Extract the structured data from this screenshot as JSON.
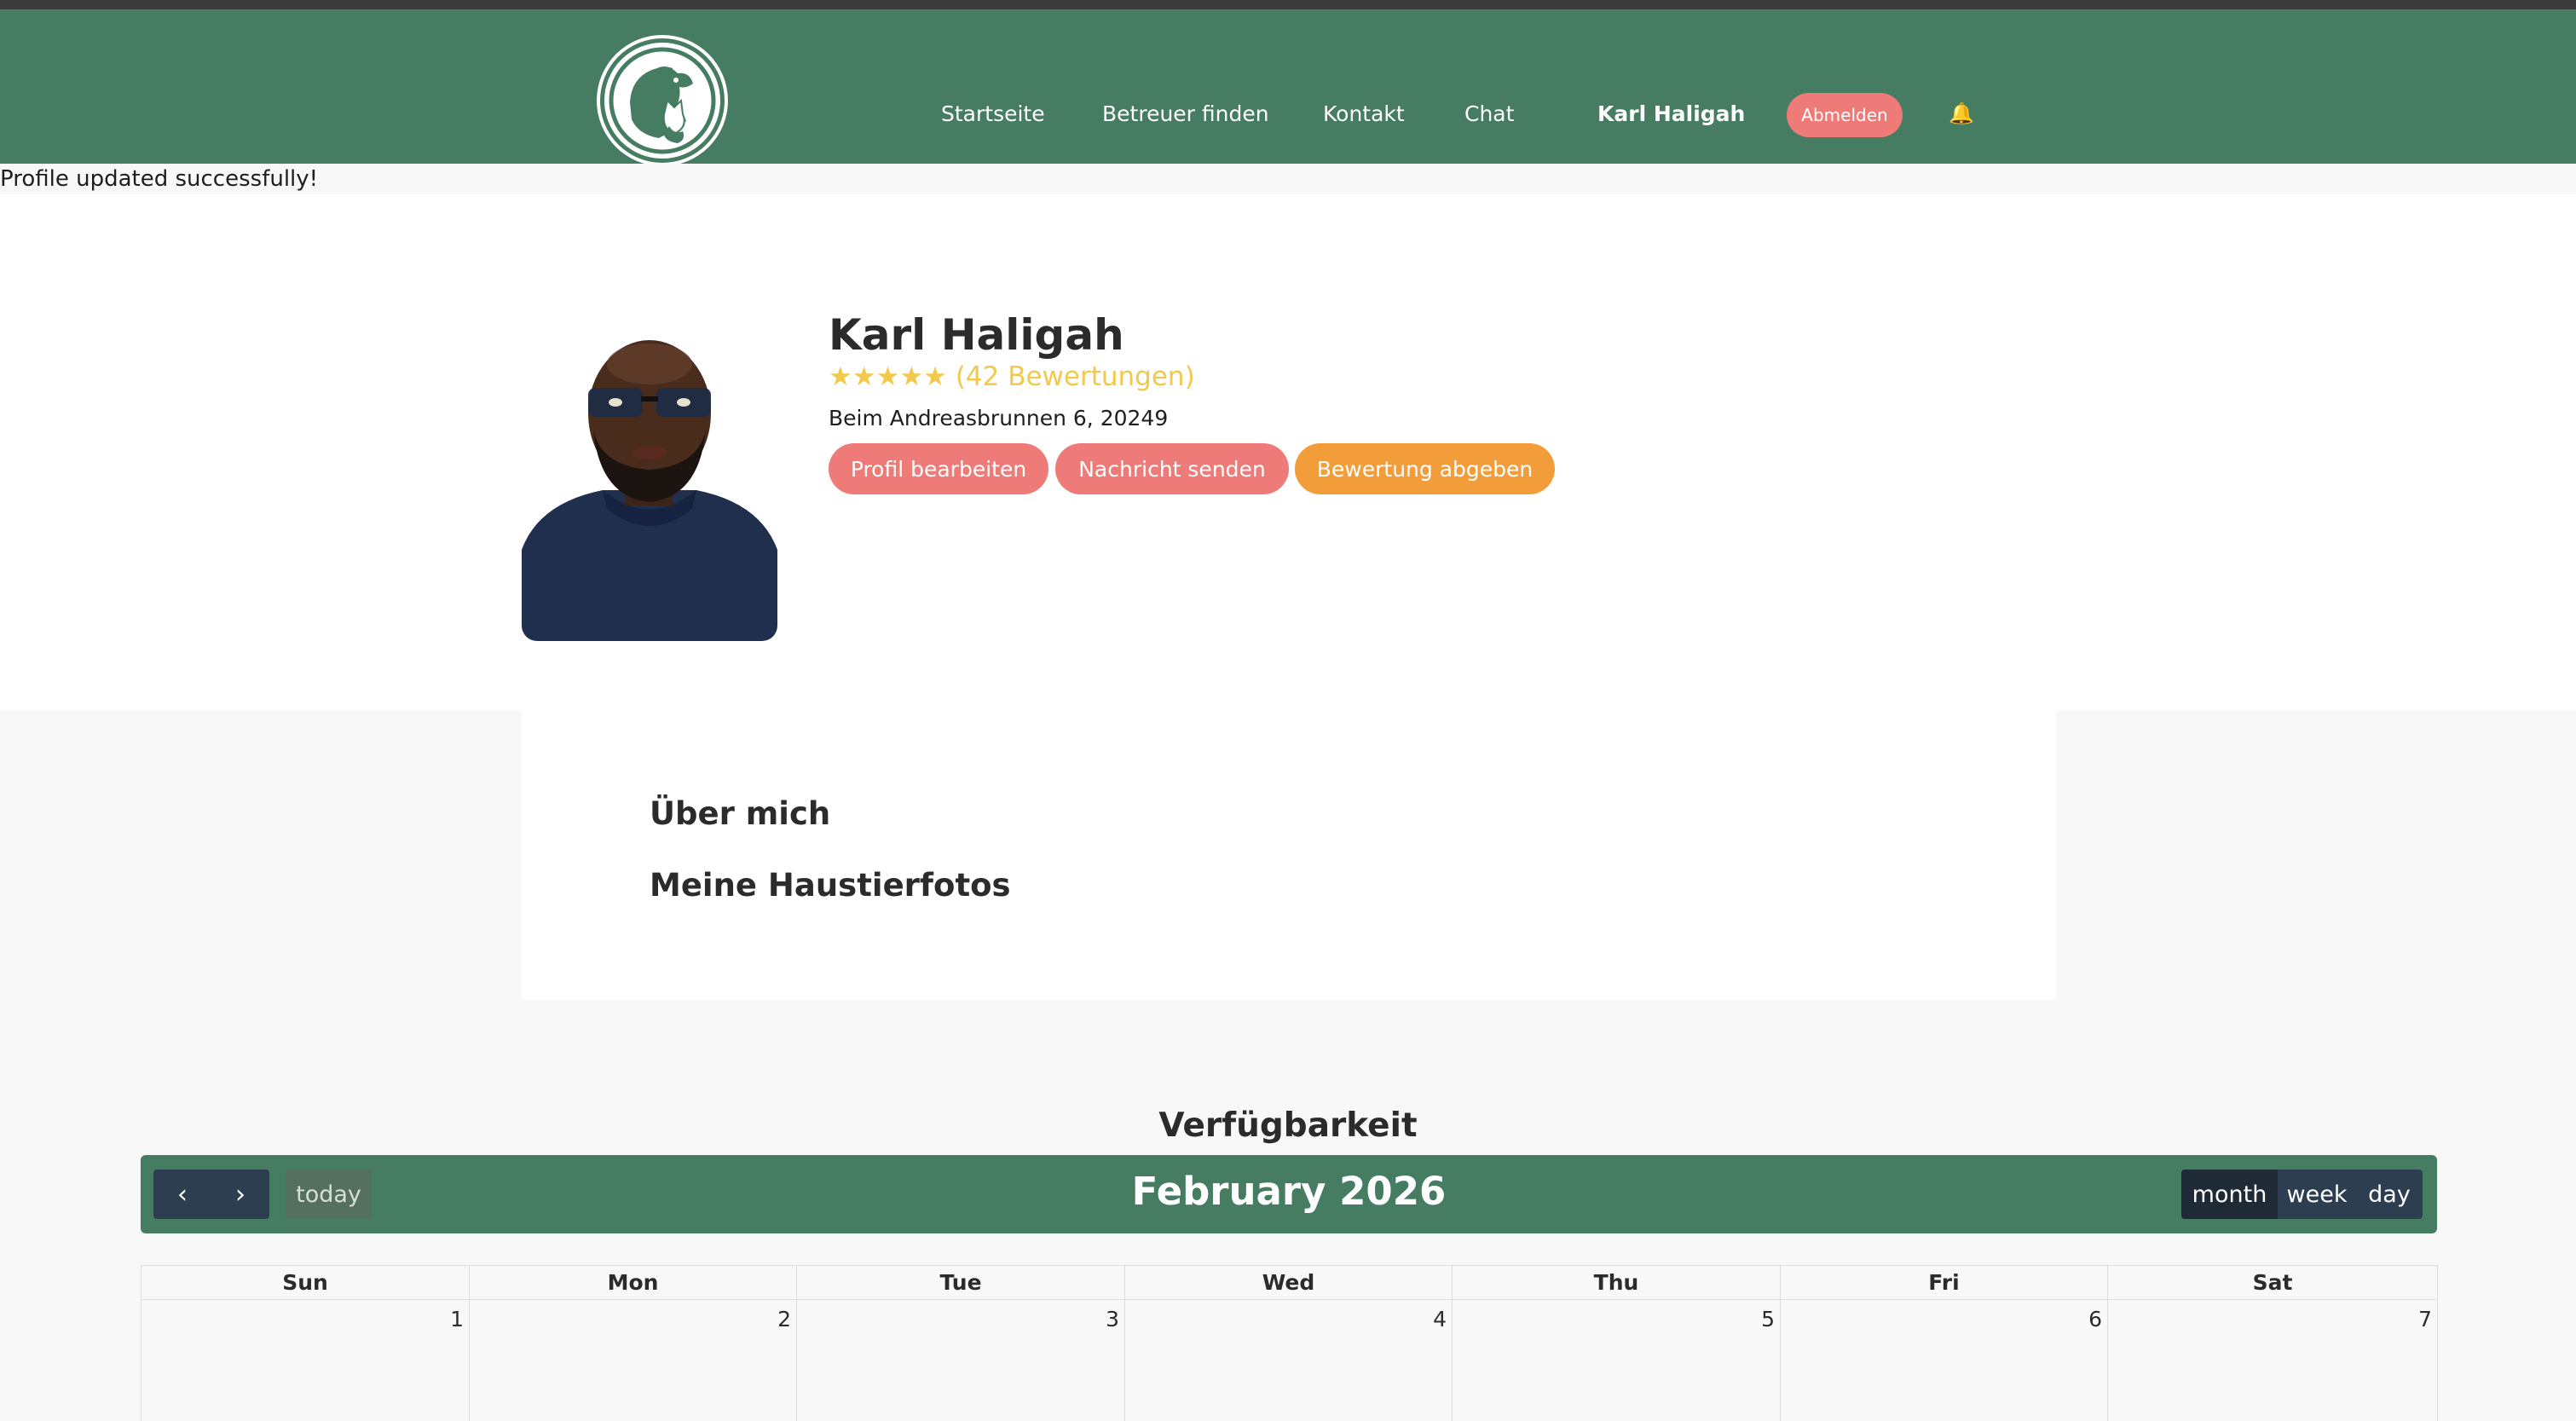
{
  "nav": {
    "links": [
      "Startseite",
      "Betreuer finden",
      "Kontakt",
      "Chat"
    ],
    "user_name": "Karl Haligah",
    "logout_label": "Abmelden",
    "bell_icon": "🔔"
  },
  "flash_message": "Profile updated successfully!",
  "profile": {
    "name": "Karl Haligah",
    "stars": "★★★★★",
    "rating_value": 5,
    "reviews_text": "(42 Bewertungen)",
    "address": "Beim Andreasbrunnen 6, 20249",
    "buttons": {
      "edit": "Profil bearbeiten",
      "message": "Nachricht senden",
      "review": "Bewertung abgeben"
    }
  },
  "about": {
    "heading": "Über mich",
    "pets_heading": "Meine Haustierfotos"
  },
  "availability": {
    "title": "Verfügbarkeit",
    "toolbar": {
      "prev_icon": "‹",
      "next_icon": "›",
      "today": "today",
      "title": "February 2026",
      "views": [
        "month",
        "week",
        "day"
      ],
      "active_view": "month"
    },
    "weekdays": [
      "Sun",
      "Mon",
      "Tue",
      "Wed",
      "Thu",
      "Fri",
      "Sat"
    ],
    "first_row_days": [
      "1",
      "2",
      "3",
      "4",
      "5",
      "6",
      "7"
    ]
  },
  "colors": {
    "primary_green": "#467c62",
    "coral": "#ee7b78",
    "orange": "#f39c3a",
    "star_yellow": "#f2c94c",
    "calendar_button": "#2c3e50"
  }
}
